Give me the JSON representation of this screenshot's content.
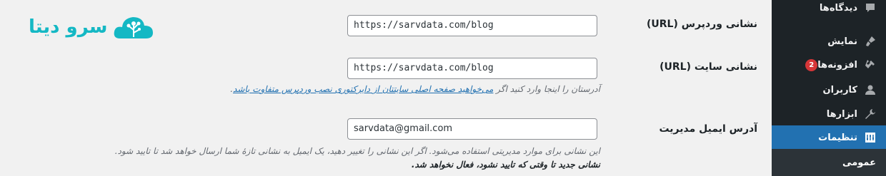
{
  "sidebar": {
    "items": [
      {
        "label": "دیدگاه‌ها",
        "icon": "comment-icon"
      },
      {
        "label": "نمایش",
        "icon": "brush-icon"
      },
      {
        "label": "افزونه‌ها",
        "icon": "plugin-icon",
        "badge": "2"
      },
      {
        "label": "کاربران",
        "icon": "user-icon"
      },
      {
        "label": "ابزارها",
        "icon": "wrench-icon"
      },
      {
        "label": "تنظیمات",
        "icon": "settings-icon"
      }
    ],
    "submenu": {
      "label": "عمومی"
    }
  },
  "logo": {
    "text": "سرو دیتا"
  },
  "fields": {
    "wp_url": {
      "label": "نشانی وردپرس (URL)",
      "value": "https://sarvdata.com/blog"
    },
    "site_url": {
      "label": "نشانی سایت (URL)",
      "value": "https://sarvdata.com/blog",
      "desc_prefix": "آدرستان را اینجا وارد کنید اگر ",
      "desc_link": "می‌خواهید صفحه اصلی سایتتان از دایرکتوری نصب وردپرس متفاوت باشد"
    },
    "admin_email": {
      "label": "آدرس ایمیل مدیریت",
      "value": "sarvdata@gmail.com",
      "desc_line1": "این نشانی برای موارد مدیریتی استفاده می‌شود. اگر این نشانی را تغییر دهید، یک ایمیل به نشانی تازهٔ شما ارسال خواهد شد تا تایید شود.",
      "desc_line2": "نشانی جدید تا وقتی که تایید نشود، فعال نخواهد شد."
    }
  }
}
